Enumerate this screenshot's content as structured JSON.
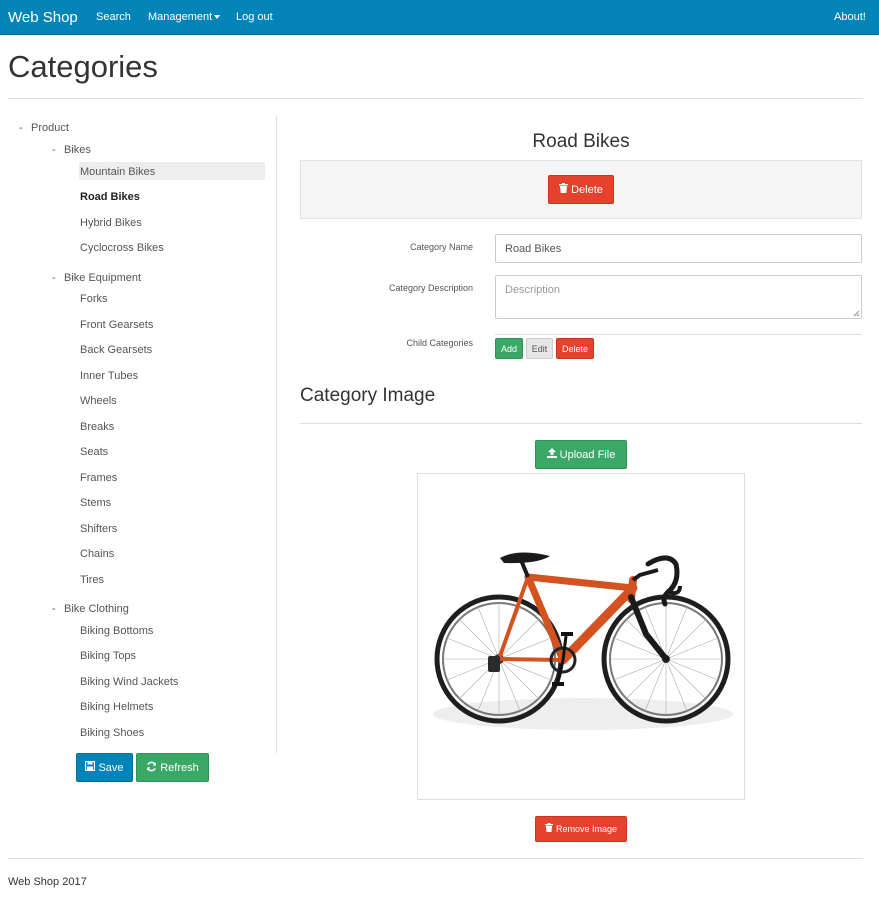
{
  "navbar": {
    "brand": "Web Shop",
    "links": {
      "search": "Search",
      "management": "Management",
      "logout": "Log out",
      "about": "About!"
    }
  },
  "page_title": "Categories",
  "tree": {
    "root": "Product",
    "groups": [
      {
        "label": "Bikes",
        "children": [
          "Mountain Bikes",
          "Road Bikes",
          "Hybrid Bikes",
          "Cyclocross Bikes"
        ]
      },
      {
        "label": "Bike Equipment",
        "children": [
          "Forks",
          "Front Gearsets",
          "Back Gearsets",
          "Inner Tubes",
          "Wheels",
          "Breaks",
          "Seats",
          "Frames",
          "Stems",
          "Shifters",
          "Chains",
          "Tires"
        ]
      },
      {
        "label": "Bike Clothing",
        "children": [
          "Biking Bottoms",
          "Biking Tops",
          "Biking Wind Jackets",
          "Biking Helmets",
          "Biking Shoes"
        ]
      }
    ],
    "hovered": "Mountain Bikes",
    "selected": "Road Bikes",
    "collapse_marker": "-"
  },
  "tree_buttons": {
    "save": "Save",
    "refresh": "Refresh"
  },
  "detail": {
    "title": "Road Bikes",
    "delete_label": "Delete",
    "fields": {
      "name_label": "Category Name",
      "name_value": "Road Bikes",
      "description_label": "Category Description",
      "description_placeholder": "Description",
      "children_label": "Child Categories"
    },
    "child_buttons": {
      "add": "Add",
      "edit": "Edit",
      "delete": "Delete"
    }
  },
  "image_section": {
    "title": "Category Image",
    "upload_label": "Upload File",
    "remove_label": "Remove Image"
  },
  "footer": {
    "text": "Web Shop 2017"
  },
  "colors": {
    "primary": "#0384b8",
    "success": "#3ca868",
    "danger": "#e5412d",
    "bike_frame": "#d4521f"
  }
}
